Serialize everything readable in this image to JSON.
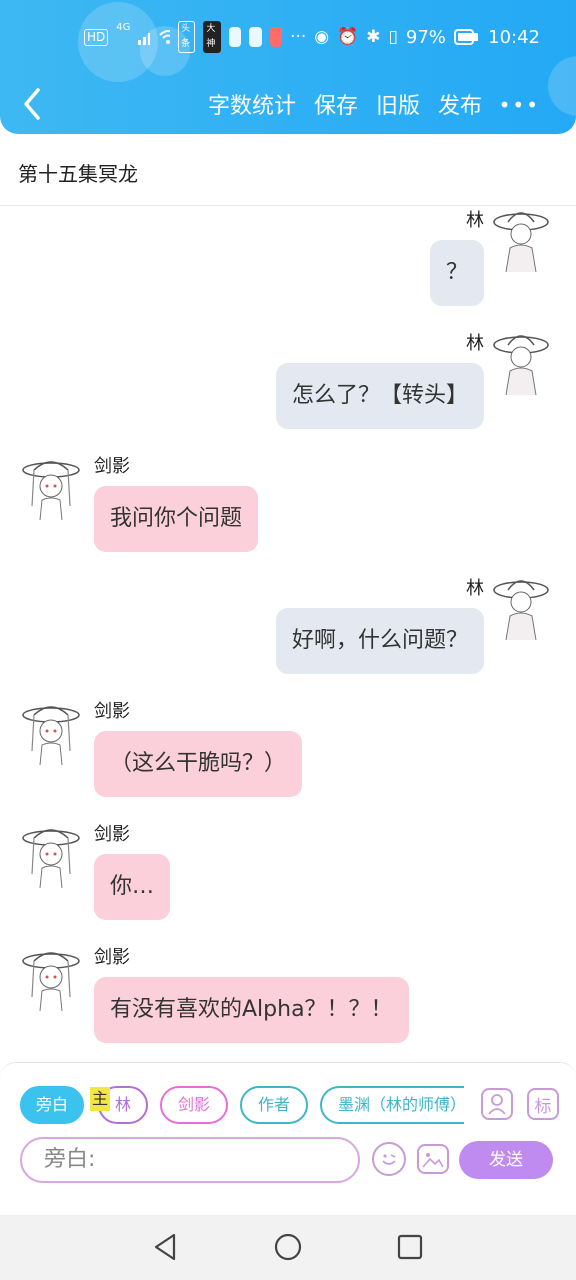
{
  "status_bar": {
    "hd": "HD",
    "network": "4G",
    "app_badges": [
      "头条",
      "大神"
    ],
    "battery_pct": "97%",
    "time": "10:42",
    "icons": [
      "hd-icon",
      "signal-icon",
      "wifi-icon",
      "toutiao-icon",
      "dashen-icon",
      "bulb-icon",
      "app-icon",
      "book-icon",
      "more-dots-icon",
      "eye-icon",
      "alarm-icon",
      "bluetooth-icon",
      "vibrate-icon",
      "battery-icon"
    ]
  },
  "header": {
    "actions": [
      "字数统计",
      "保存",
      "旧版",
      "发布"
    ],
    "more": "•••",
    "colors": {
      "gradient_start": "#3db8f2",
      "gradient_end": "#24a9f5"
    }
  },
  "episode_title": "第十五集冥龙",
  "messages": [
    {
      "side": "right",
      "nick": "林",
      "text": "？"
    },
    {
      "side": "right",
      "nick": "林",
      "text": "怎么了？【转头】"
    },
    {
      "side": "left",
      "nick": "剑影",
      "text": "我问你个问题"
    },
    {
      "side": "right",
      "nick": "林",
      "text": "好啊，什么问题？"
    },
    {
      "side": "left",
      "nick": "剑影",
      "text": "（这么干脆吗？）"
    },
    {
      "side": "left",
      "nick": "剑影",
      "text": "你…"
    },
    {
      "side": "left",
      "nick": "剑影",
      "text": "有没有喜欢的Alpha？！？！"
    }
  ],
  "composer": {
    "chips": [
      {
        "label": "旁白",
        "selected": true,
        "color": "#3cc2ef"
      },
      {
        "label": "林",
        "selected": false,
        "color": "#b36fd6"
      },
      {
        "label": "剑影",
        "selected": false,
        "color": "#e46fd8"
      },
      {
        "label": "作者",
        "selected": false,
        "color": "#3fb6c6"
      },
      {
        "label": "墨渊（林的师傅）",
        "selected": false,
        "color": "#3fb6c6"
      }
    ],
    "main_tag": "主",
    "mark_label": "标",
    "input_placeholder": "旁白:",
    "send_label": "发送",
    "colors": {
      "send": "#c08bf0",
      "input_border": "#d9a8e0",
      "bubble_left": "#fcd0da",
      "bubble_right": "#e4e8f0"
    }
  }
}
